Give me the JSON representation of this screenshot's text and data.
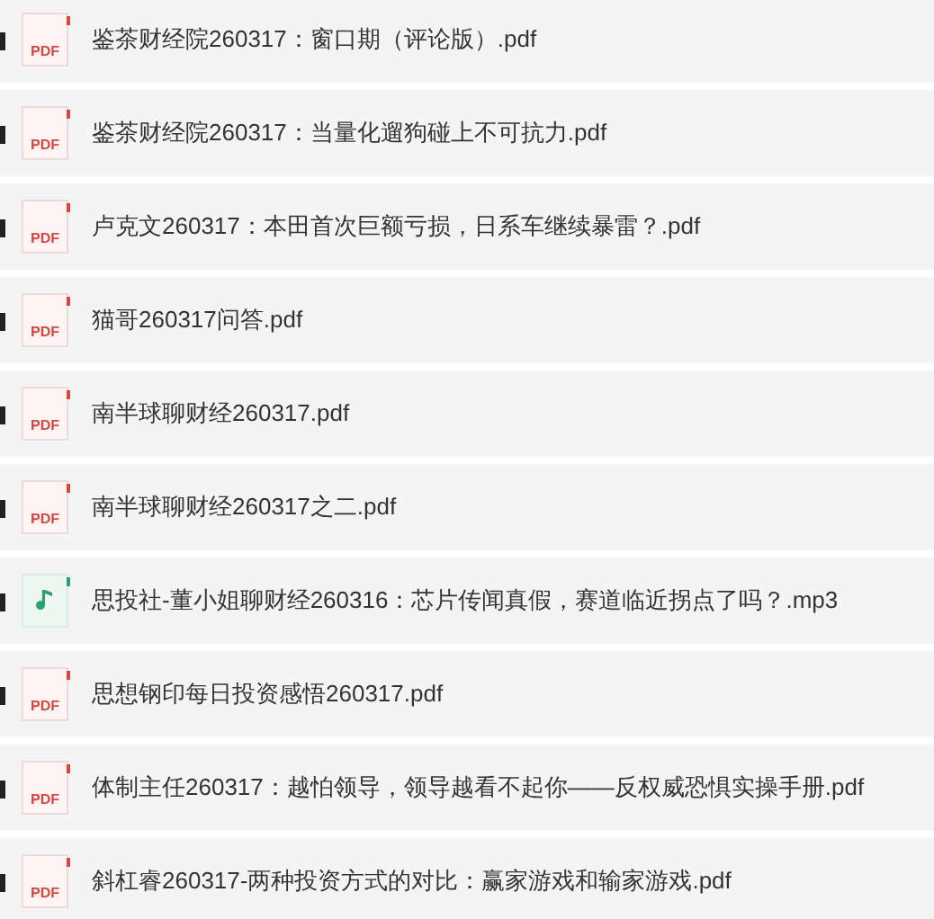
{
  "files": [
    {
      "kind": "pdf",
      "icon_label": "PDF",
      "name": "鉴茶财经院260317：窗口期（评论版）.pdf"
    },
    {
      "kind": "pdf",
      "icon_label": "PDF",
      "name": "鉴茶财经院260317：当量化遛狗碰上不可抗力.pdf"
    },
    {
      "kind": "pdf",
      "icon_label": "PDF",
      "name": "卢克文260317：本田首次巨额亏损，日系车继续暴雷？.pdf"
    },
    {
      "kind": "pdf",
      "icon_label": "PDF",
      "name": "猫哥260317问答.pdf"
    },
    {
      "kind": "pdf",
      "icon_label": "PDF",
      "name": "南半球聊财经260317.pdf"
    },
    {
      "kind": "pdf",
      "icon_label": "PDF",
      "name": "南半球聊财经260317之二.pdf"
    },
    {
      "kind": "audio",
      "name": "思投社-董小姐聊财经260316：芯片传闻真假，赛道临近拐点了吗？.mp3"
    },
    {
      "kind": "pdf",
      "icon_label": "PDF",
      "name": "思想钢印每日投资感悟260317.pdf"
    },
    {
      "kind": "pdf",
      "icon_label": "PDF",
      "name": "体制主任260317：越怕领导，领导越看不起你——反权威恐惧实操手册.pdf"
    },
    {
      "kind": "pdf",
      "icon_label": "PDF",
      "name": "斜杠睿260317-两种投资方式的对比：赢家游戏和输家游戏.pdf"
    }
  ]
}
